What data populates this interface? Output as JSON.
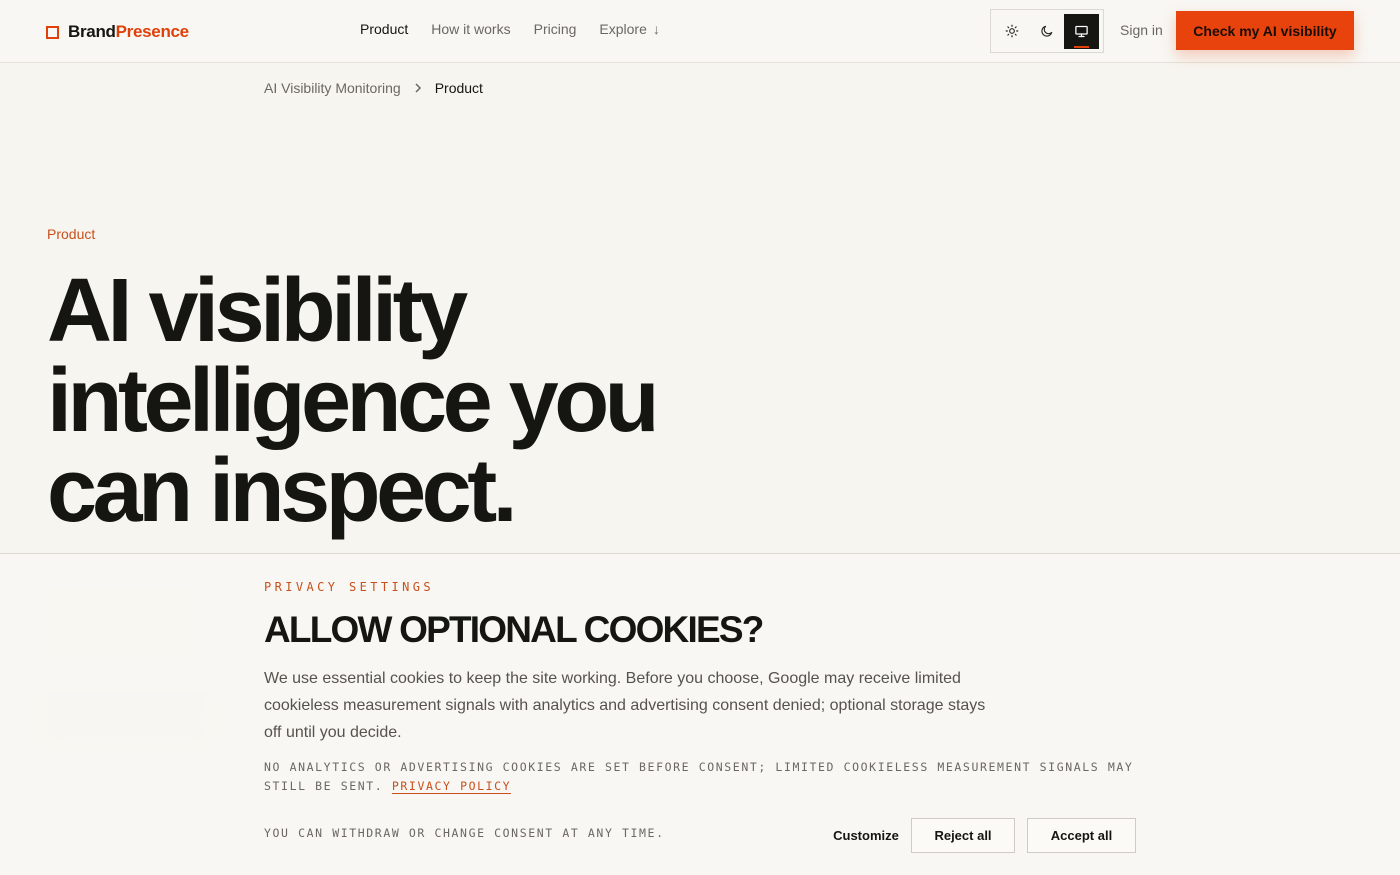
{
  "header": {
    "brand": {
      "part1": "Brand",
      "part2": "Presence"
    },
    "nav": [
      {
        "label": "Product",
        "active": true
      },
      {
        "label": "How it works",
        "active": false
      },
      {
        "label": "Pricing",
        "active": false
      },
      {
        "label": "Explore",
        "active": false
      }
    ],
    "explore_arrow": "↓",
    "theme_options": [
      "sun-icon",
      "moon-icon",
      "monitor-icon"
    ],
    "theme_selected": "monitor-icon",
    "sign_in": "Sign in",
    "cta": "Check my AI visibility"
  },
  "breadcrumb": {
    "parent": "AI Visibility Monitoring",
    "separator": "›",
    "current": "Product"
  },
  "hero": {
    "eyebrow": "Product",
    "title_lines": [
      "AI visibility",
      "intelligence you",
      "can inspect."
    ]
  },
  "cookie": {
    "eyebrow": "PRIVACY SETTINGS",
    "title": "ALLOW OPTIONAL COOKIES?",
    "body": "We use essential cookies to keep the site working. Before you choose, Google may receive limited cookieless measurement signals with analytics and advertising consent denied; optional storage stays off until you decide.",
    "note": "NO ANALYTICS OR ADVERTISING COOKIES ARE SET BEFORE CONSENT; LIMITED COOKIELESS MEASUREMENT SIGNALS MAY STILL BE SENT.",
    "policy_link": "PRIVACY POLICY",
    "withdraw": "YOU CAN WITHDRAW OR CHANGE CONSENT AT ANY TIME.",
    "customize": "Customize",
    "reject": "Reject all",
    "accept": "Accept all"
  },
  "colors": {
    "accent": "#e8430c",
    "background": "#f7f5f0",
    "text": "#151512",
    "muted": "#6b6862"
  }
}
